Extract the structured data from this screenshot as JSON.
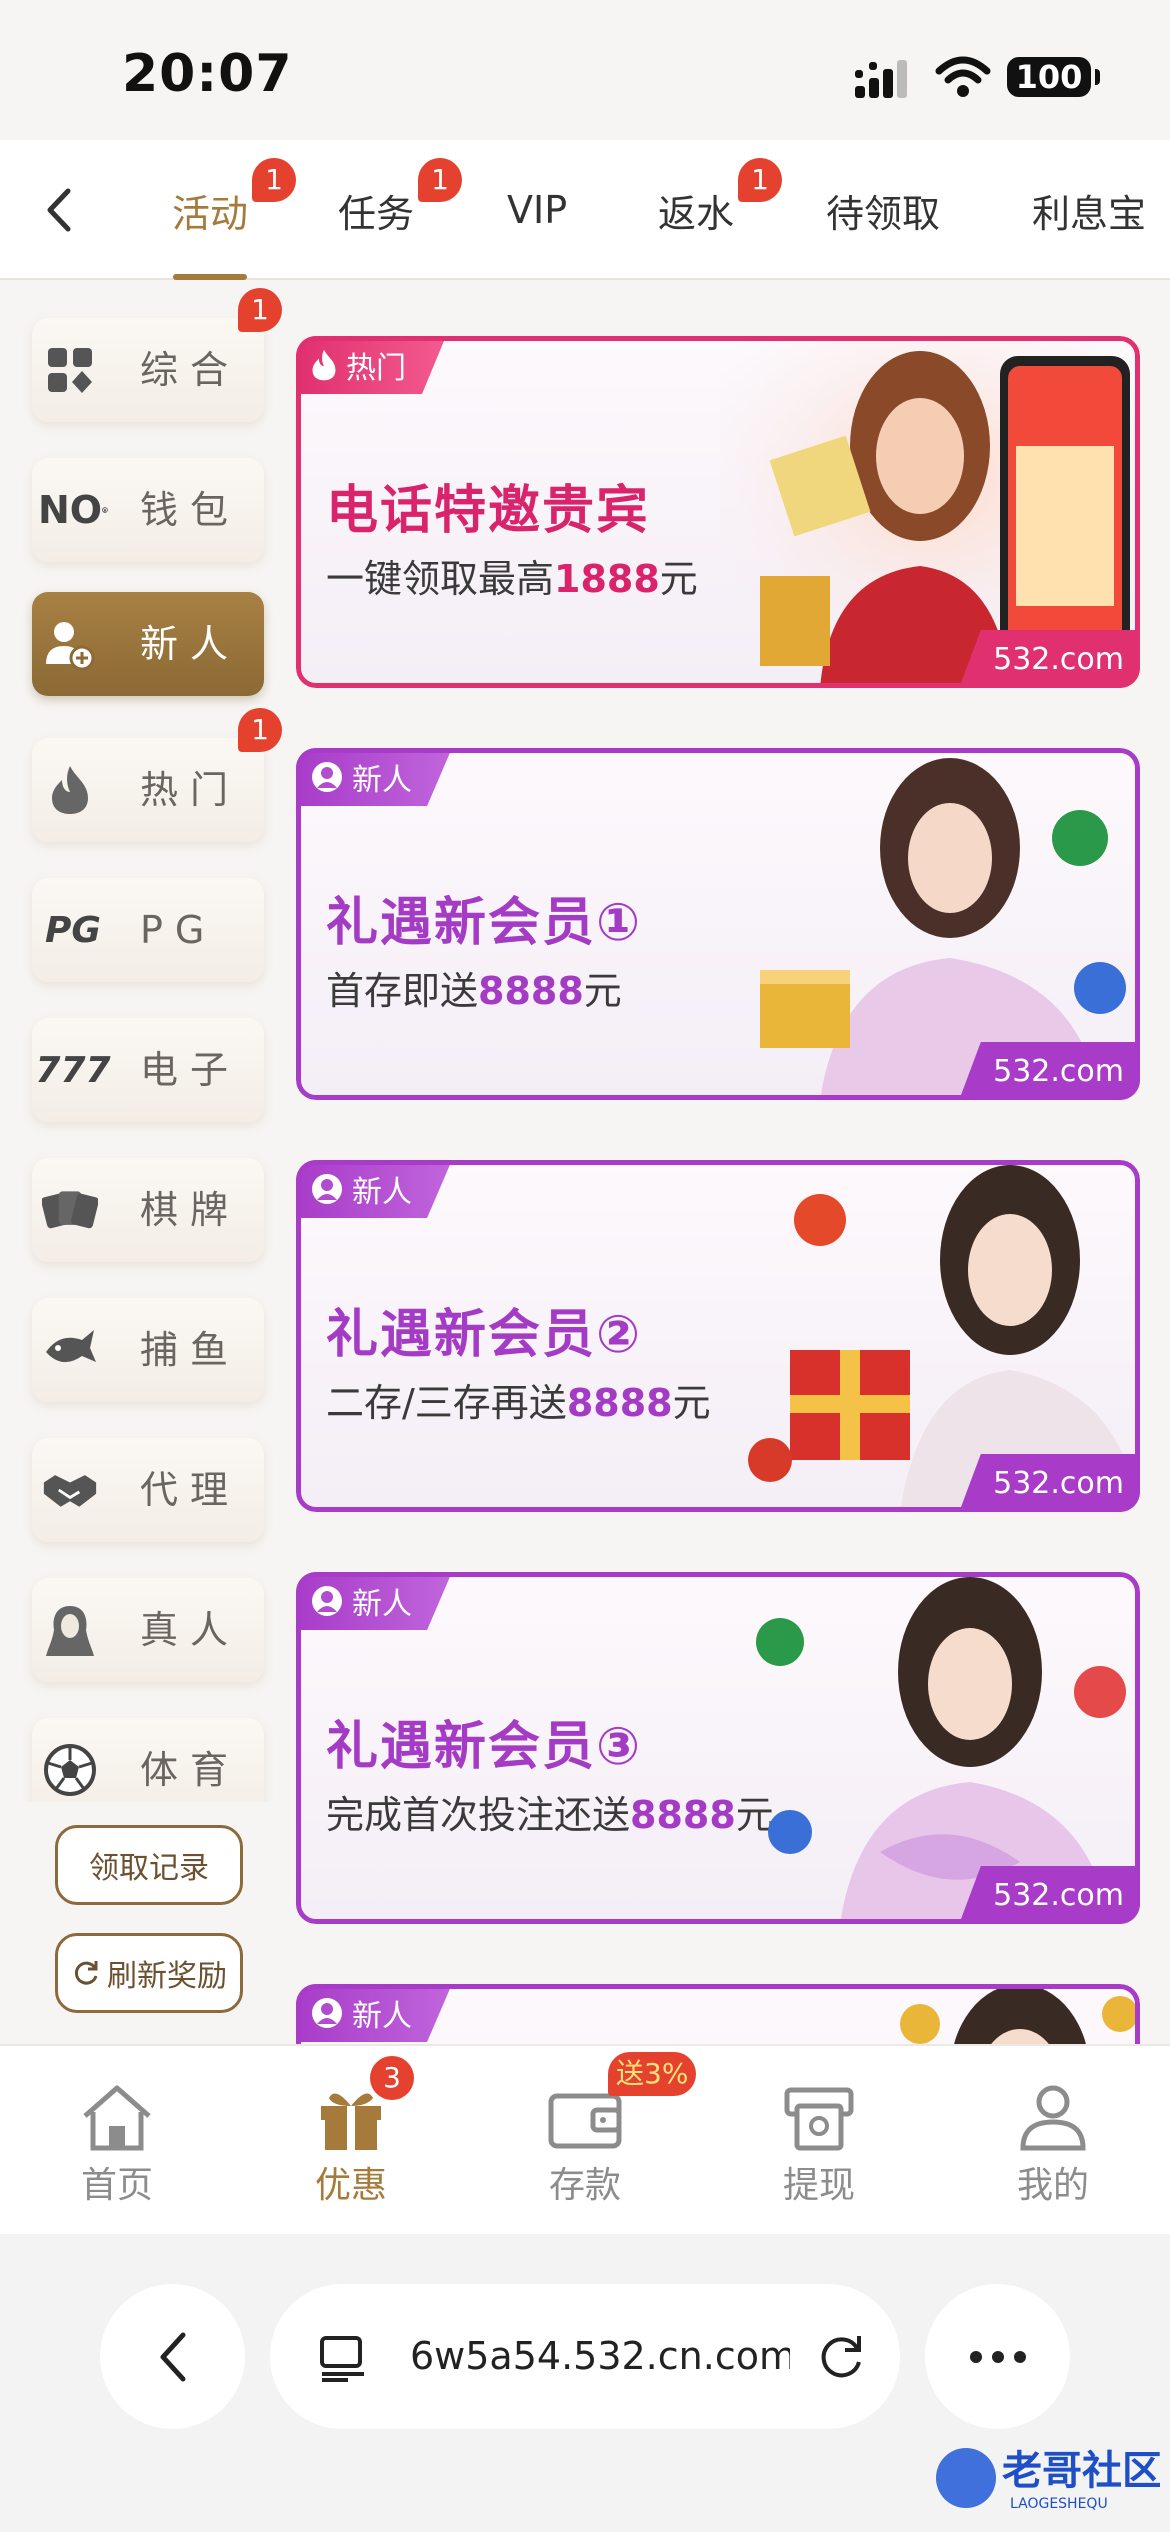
{
  "status": {
    "time": "20:07",
    "battery": "100"
  },
  "tabs": [
    {
      "label": "活动",
      "badge": "1",
      "active": true
    },
    {
      "label": "任务",
      "badge": "1"
    },
    {
      "label": "VIP",
      "badge": ""
    },
    {
      "label": "返水",
      "badge": "1"
    },
    {
      "label": "待领取",
      "badge": ""
    },
    {
      "label": "利息宝",
      "badge": ""
    }
  ],
  "sidebar": {
    "items": [
      {
        "label": "综合",
        "icon": "grid-icon",
        "badge": "1"
      },
      {
        "label": "钱包",
        "icon": "nob-logo-icon",
        "icon_text": "NO"
      },
      {
        "label": "新人",
        "icon": "new-user-icon",
        "active": true
      },
      {
        "label": "热门",
        "icon": "fire-icon",
        "badge": "1"
      },
      {
        "label": "PG",
        "icon": "pg-logo-icon",
        "icon_text": "PG"
      },
      {
        "label": "电子",
        "icon": "slot-777-icon",
        "icon_text": "777"
      },
      {
        "label": "棋牌",
        "icon": "cards-icon"
      },
      {
        "label": "捕鱼",
        "icon": "fish-icon"
      },
      {
        "label": "代理",
        "icon": "handshake-icon"
      },
      {
        "label": "真人",
        "icon": "dealer-icon"
      },
      {
        "label": "体育",
        "icon": "soccer-ball-icon"
      }
    ],
    "record_button": "领取记录",
    "refresh_button": "刷新奖励"
  },
  "banners": [
    {
      "tag": "热门",
      "title": "电话特邀贵宾",
      "sub_prefix": "一键领取最高",
      "sub_amount": "1888",
      "sub_suffix": "元",
      "domain": "532.com",
      "accent": "#e0306f"
    },
    {
      "tag": "新人",
      "title": "礼遇新会员①",
      "sub_prefix": "首存即送",
      "sub_amount": "8888",
      "sub_suffix": "元",
      "domain": "532.com",
      "accent": "#a83cc9"
    },
    {
      "tag": "新人",
      "title": "礼遇新会员②",
      "sub_prefix": "二存/三存再送",
      "sub_amount": "8888",
      "sub_suffix": "元",
      "domain": "532.com",
      "accent": "#a83cc9"
    },
    {
      "tag": "新人",
      "title": "礼遇新会员③",
      "sub_prefix": "完成首次投注还送",
      "sub_amount": "8888",
      "sub_suffix": "元",
      "domain": "532.com",
      "accent": "#a83cc9"
    },
    {
      "tag": "新人"
    }
  ],
  "bottom_nav": [
    {
      "label": "首页",
      "icon": "home-icon"
    },
    {
      "label": "优惠",
      "icon": "gift-icon",
      "badge": "3",
      "active": true
    },
    {
      "label": "存款",
      "icon": "wallet-icon",
      "badge": "送3%"
    },
    {
      "label": "提现",
      "icon": "withdraw-icon"
    },
    {
      "label": "我的",
      "icon": "profile-icon"
    }
  ],
  "browser": {
    "url": "6w5a54.532.cn.com"
  },
  "watermark": {
    "text": "老哥社区",
    "sub": "LAOGESHEQU"
  },
  "colors": {
    "brand_gold": "#a57a3b",
    "badge_red": "#e5412f",
    "banner_purple": "#a83cc9",
    "banner_pink": "#e0306f"
  }
}
